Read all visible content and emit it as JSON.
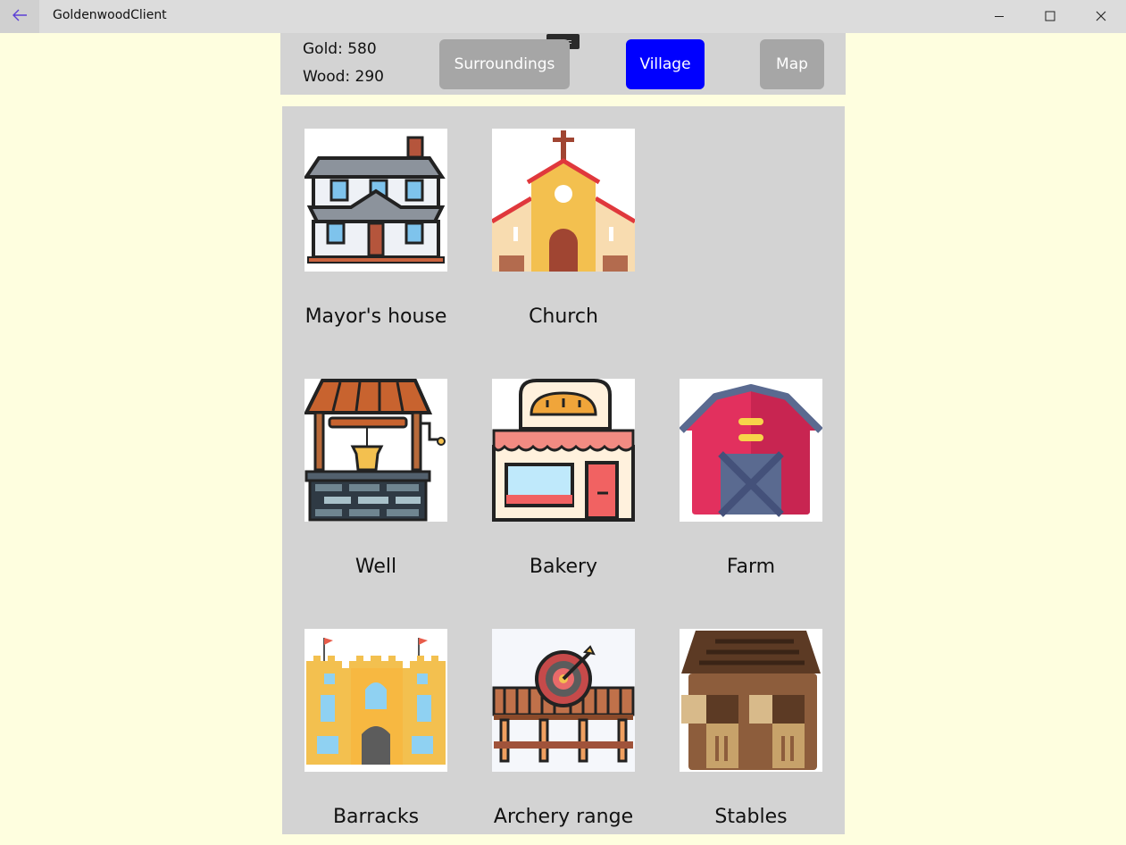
{
  "window": {
    "title": "GoldenwoodClient"
  },
  "resources": {
    "gold_label": "Gold:",
    "gold_value": "580",
    "wood_label": "Wood:",
    "wood_value": "290"
  },
  "nav": {
    "surroundings": "Surroundings",
    "village": "Village",
    "map": "Map",
    "active": "Village",
    "active_color": "#0000ff",
    "inactive_color": "#a6a6a6"
  },
  "buildings": [
    {
      "name": "Mayor's house",
      "icon": "mayors-house-icon"
    },
    {
      "name": "Church",
      "icon": "church-icon"
    },
    {
      "name": "Well",
      "icon": "well-icon"
    },
    {
      "name": "Bakery",
      "icon": "bakery-icon"
    },
    {
      "name": "Farm",
      "icon": "farm-icon"
    },
    {
      "name": "Barracks",
      "icon": "barracks-icon"
    },
    {
      "name": "Archery range",
      "icon": "archery-range-icon"
    },
    {
      "name": "Stables",
      "icon": "stables-icon"
    }
  ],
  "colors": {
    "page_background": "#fefedf",
    "panel_background": "#d3d3d3"
  }
}
